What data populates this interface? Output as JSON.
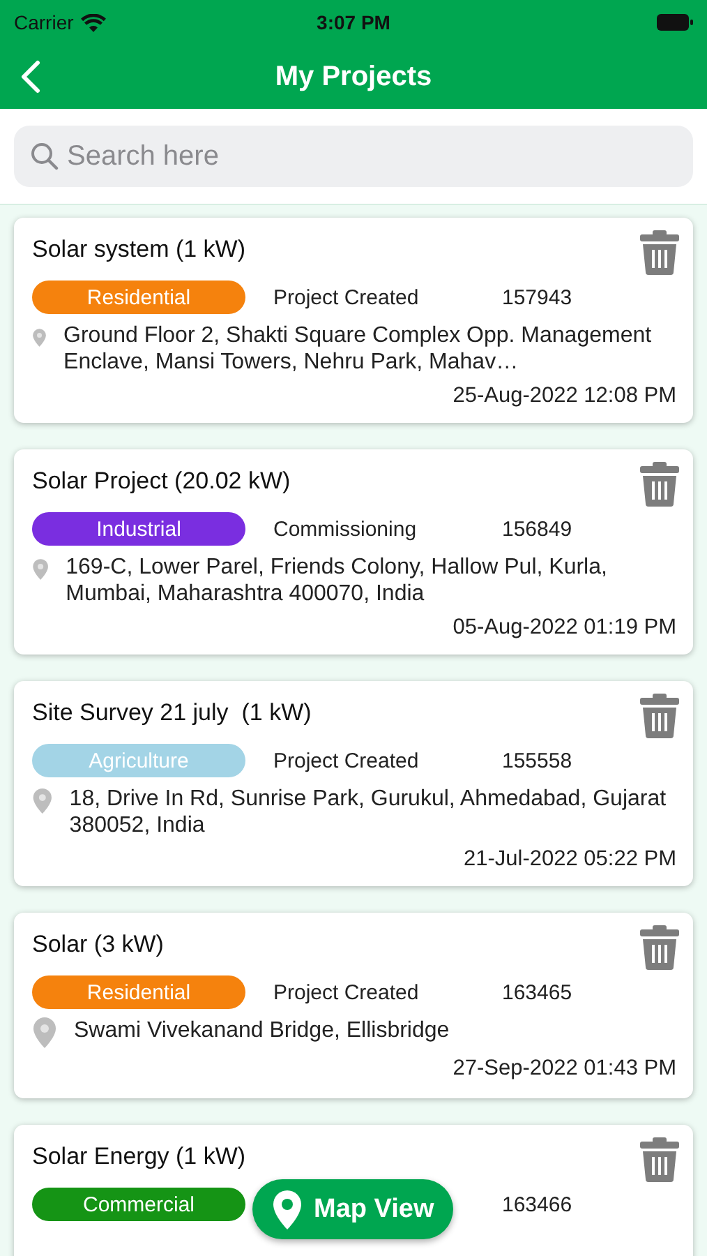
{
  "status_bar": {
    "carrier": "Carrier",
    "time": "3:07 PM"
  },
  "nav": {
    "title": "My Projects"
  },
  "search": {
    "placeholder": "Search here"
  },
  "projects": [
    {
      "title": "Solar system (1 kW)",
      "type": "Residential",
      "color": "#f5820d",
      "status": "Project Created",
      "id": "157943",
      "address": "Ground Floor 2, Shakti Square Complex Opp. Management Enclave, Mansi Towers, Nehru Park, Mahav…",
      "date": "25-Aug-2022 12:08 PM"
    },
    {
      "title": "Solar Project (20.02 kW)",
      "type": "Industrial",
      "color": "#7a2ee0",
      "status": "Commissioning",
      "id": "156849",
      "address": "169-C, Lower Parel, Friends Colony, Hallow Pul, Kurla, Mumbai, Maharashtra 400070, India",
      "date": "05-Aug-2022 01:19 PM"
    },
    {
      "title": "Site Survey 21 july  (1 kW)",
      "type": "Agriculture",
      "color": "#a3d4e6",
      "status": "Project Created",
      "id": "155558",
      "address": "18, Drive In Rd, Sunrise Park, Gurukul, Ahmedabad, Gujarat 380052, India",
      "date": "21-Jul-2022 05:22 PM"
    },
    {
      "title": "Solar (3 kW)",
      "type": "Residential",
      "color": "#f5820d",
      "status": "Project Created",
      "id": "163465",
      "address": "Swami Vivekanand Bridge, Ellisbridge",
      "date": "27-Sep-2022 01:43 PM"
    },
    {
      "title": "Solar Energy (1 kW)",
      "type": "Commercial",
      "color": "#159415",
      "id": "163466"
    }
  ],
  "map_button": {
    "label": "Map View"
  }
}
